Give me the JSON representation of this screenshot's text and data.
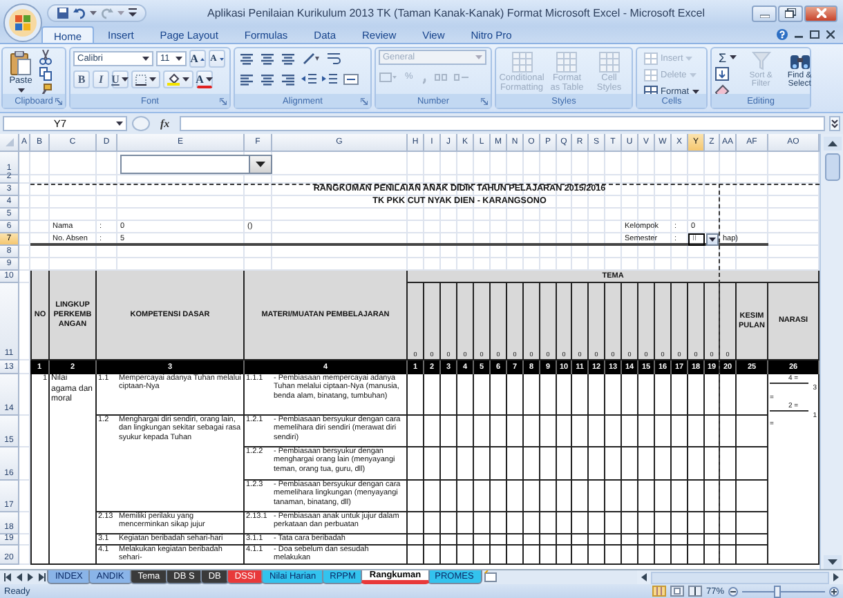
{
  "window": {
    "title": "Aplikasi Penilaian Kurikulum 2013 TK (Taman Kanak-Kanak) Format Microsoft Excel - Microsoft Excel"
  },
  "ribbon": {
    "tabs": [
      {
        "label": "Home",
        "selected": true
      },
      {
        "label": "Insert",
        "selected": false
      },
      {
        "label": "Page Layout",
        "selected": false
      },
      {
        "label": "Formulas",
        "selected": false
      },
      {
        "label": "Data",
        "selected": false
      },
      {
        "label": "Review",
        "selected": false
      },
      {
        "label": "View",
        "selected": false
      },
      {
        "label": "Nitro Pro",
        "selected": false
      }
    ],
    "clipboard": {
      "label": "Clipboard",
      "paste": "Paste"
    },
    "font": {
      "label": "Font",
      "family": "Calibri",
      "size": "11",
      "grow": "A",
      "shrink": "A",
      "styles": [
        "B",
        "I",
        "U"
      ],
      "font_color": "A"
    },
    "alignment": {
      "label": "Alignment"
    },
    "number": {
      "label": "Number",
      "format": "General",
      "percent": "%",
      "disabled": true
    },
    "styles": {
      "label": "Styles",
      "buttons": [
        {
          "label": "Conditional Formatting",
          "disabled": true
        },
        {
          "label": "Format as Table",
          "disabled": true
        },
        {
          "label": "Cell Styles",
          "disabled": true
        }
      ]
    },
    "cells": {
      "label": "Cells",
      "buttons": [
        {
          "label": "Insert",
          "disabled": true
        },
        {
          "label": "Delete",
          "disabled": true
        },
        {
          "label": "Format",
          "disabled": false
        }
      ]
    },
    "editing": {
      "label": "Editing",
      "sum": "Σ",
      "buttons": [
        {
          "label": "Sort & Filter",
          "disabled": true
        },
        {
          "label": "Find & Select",
          "disabled": false
        }
      ]
    }
  },
  "formula_bar": {
    "name_box": "Y7",
    "function_label": "fx"
  },
  "sheet": {
    "columns": [
      {
        "label": "A",
        "selected": false
      },
      {
        "label": "B",
        "selected": false
      },
      {
        "label": "C",
        "selected": false
      },
      {
        "label": "D",
        "selected": false
      },
      {
        "label": "E",
        "selected": false
      },
      {
        "label": "F",
        "selected": false
      },
      {
        "label": "G",
        "selected": false
      },
      {
        "label": "H",
        "selected": false
      },
      {
        "label": "I",
        "selected": false
      },
      {
        "label": "J",
        "selected": false
      },
      {
        "label": "K",
        "selected": false
      },
      {
        "label": "L",
        "selected": false
      },
      {
        "label": "M",
        "selected": false
      },
      {
        "label": "N",
        "selected": false
      },
      {
        "label": "O",
        "selected": false
      },
      {
        "label": "P",
        "selected": false
      },
      {
        "label": "Q",
        "selected": false
      },
      {
        "label": "R",
        "selected": false
      },
      {
        "label": "S",
        "selected": false
      },
      {
        "label": "T",
        "selected": false
      },
      {
        "label": "U",
        "selected": false
      },
      {
        "label": "V",
        "selected": false
      },
      {
        "label": "W",
        "selected": false
      },
      {
        "label": "X",
        "selected": false
      },
      {
        "label": "Y",
        "selected": true
      },
      {
        "label": "Z",
        "selected": false
      },
      {
        "label": "AA",
        "selected": false
      },
      {
        "label": "AF",
        "selected": false
      },
      {
        "label": "AO",
        "selected": false
      }
    ],
    "rows": [
      {
        "label": "1",
        "selected": false
      },
      {
        "label": "2",
        "selected": false
      },
      {
        "label": "3",
        "selected": false
      },
      {
        "label": "4",
        "selected": false
      },
      {
        "label": "5",
        "selected": false
      },
      {
        "label": "6",
        "selected": false
      },
      {
        "label": "7",
        "selected": true
      },
      {
        "label": "8",
        "selected": false
      },
      {
        "label": "9",
        "selected": false
      },
      {
        "label": "10",
        "selected": false
      },
      {
        "label": "11",
        "selected": false
      },
      {
        "label": "13",
        "selected": false
      },
      {
        "label": "14",
        "selected": false
      },
      {
        "label": "15",
        "selected": false
      },
      {
        "label": "16",
        "selected": false
      },
      {
        "label": "17",
        "selected": false
      },
      {
        "label": "18",
        "selected": false
      },
      {
        "label": "19",
        "selected": false
      },
      {
        "label": "20",
        "selected": false
      }
    ],
    "title": "RANGKUMAN PENILAIAN ANAK DIDIK TAHUN PELAJARAN 2015/2016",
    "school": "TK PKK CUT NYAK DIEN - KARANGSONO",
    "student": {
      "name_label": "Nama",
      "name_colon": ":",
      "name_value": "0",
      "name_extra": "()",
      "absen_label": "No. Absen",
      "absen_colon": ":",
      "absen_value": "5",
      "kelompok_label": "Kelompok",
      "kelompok_colon": ":",
      "kelompok_value": "0",
      "semester_label": "Semester",
      "semester_colon": ":",
      "semester_value": "II",
      "semester_note": "hap)"
    },
    "headers": {
      "no": "NO",
      "lingkup": "LINGKUP PERKEMBANGAN",
      "kompetensi": "KOMPETENSI DASAR",
      "materi": "MATERI/MUATAN PEMBELAJARAN",
      "tema": "TEMA",
      "tema_marks": [
        "0",
        "0",
        "0",
        "0",
        "0",
        "0",
        "0",
        "0",
        "0",
        "0",
        "0",
        "0",
        "0",
        "0",
        "0",
        "0",
        "0",
        "0",
        "0",
        "0"
      ],
      "kesimpulan": "KESIMPULAN",
      "narasi": "NARASI"
    },
    "column_numbers": [
      "1",
      "2",
      "3",
      "4",
      "1",
      "2",
      "3",
      "4",
      "5",
      "6",
      "7",
      "8",
      "9",
      "10",
      "11",
      "12",
      "13",
      "14",
      "15",
      "16",
      "17",
      "18",
      "19",
      "20",
      "25",
      "26"
    ],
    "groups": [
      {
        "no": "1",
        "lingkup": "Nilai agama dan moral",
        "entries": [
          {
            "kd_no": "1.1",
            "kd_text": "Mempercayai adanya Tuhan melalui ciptaan-Nya",
            "materi_no": "1.1.1",
            "materi_text": "- Pembiasaan mempercayai adanya Tuhan melalui ciptaan-Nya (manusia, benda alam, binatang, tumbuhan)"
          },
          {
            "kd_no": "1.2",
            "kd_text": "Menghargai diri sendiri, orang lain, dan lingkungan sekitar sebagai rasa syukur kepada Tuhan",
            "materi_no": "1.2.1",
            "materi_text": "- Pembiasaan bersyukur dengan cara memelihara diri sendiri (merawat diri sendiri)"
          },
          {
            "materi_no": "1.2.2",
            "materi_text": "- Pembiasaan bersyukur dengan menghargai orang lain (menyayangi teman, orang tua, guru, dll)"
          },
          {
            "materi_no": "1.2.3",
            "materi_text": "- Pembiasaan bersyukur dengan cara memelihara lingkungan (menyayangi tanaman, binatang, dll)"
          },
          {
            "kd_no": "2.13",
            "kd_text": "Memiliki perilaku yang mencerminkan sikap jujur",
            "materi_no": "2.13.1",
            "materi_text": "- Pembiasaan anak untuk jujur dalam perkataan dan perbuatan"
          },
          {
            "kd_no": "3.1",
            "kd_text": "Kegiatan beribadah sehari-hari",
            "materi_no": "3.1.1",
            "materi_text": "- Tata cara beribadah"
          },
          {
            "kd_no": "4.1",
            "kd_text": "Melakukan kegiatan beribadah sehari-",
            "materi_no": "4.1.1",
            "materi_text": "- Doa sebelum dan sesudah melakukan"
          }
        ]
      }
    ],
    "narasi": [
      "4 =",
      "3",
      "=",
      "2 =",
      "1",
      "="
    ]
  },
  "sheet_tabs": [
    {
      "label": "INDEX",
      "color": "#8ab4e8",
      "selected": false
    },
    {
      "label": "ANDIK",
      "color": "#8ab4e8",
      "selected": false
    },
    {
      "label": "Tema",
      "color": "#3a3a3a",
      "selected": false
    },
    {
      "label": "DB S",
      "color": "#3a3a3a",
      "selected": false
    },
    {
      "label": "DB",
      "color": "#3a3a3a",
      "selected": false
    },
    {
      "label": "DSSI",
      "color": "#e8393a",
      "selected": false
    },
    {
      "label": "Nilai Harian",
      "color": "#33c3ee",
      "selected": false
    },
    {
      "label": "RPPM",
      "color": "#33c3ee",
      "selected": false
    },
    {
      "label": "Rangkuman",
      "color": "#e8393a",
      "selected": true
    },
    {
      "label": "PROMES",
      "color": "#33c3ee",
      "selected": false
    }
  ],
  "status_bar": {
    "status": "Ready",
    "zoom": "77%",
    "zoom_slider": {
      "level": 0.42
    }
  }
}
